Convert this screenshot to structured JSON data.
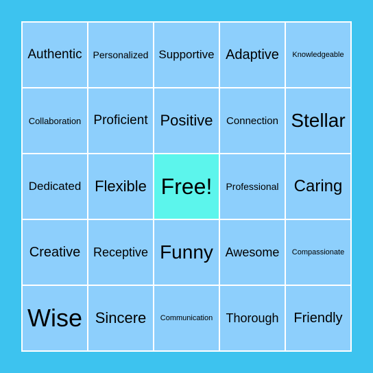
{
  "board": {
    "colors": {
      "background": "#3dc3ef",
      "cell": "#8dcffc",
      "free_cell": "#5cf5ec",
      "grid_lines": "#ffffff"
    },
    "rows": [
      [
        "Authentic",
        "Personalized",
        "Supportive",
        "Adaptive",
        "Knowledgeable"
      ],
      [
        "Collaboration",
        "Proficient",
        "Positive",
        "Connection",
        "Stellar"
      ],
      [
        "Dedicated",
        "Flexible",
        "Free!",
        "Professional",
        "Caring"
      ],
      [
        "Creative",
        "Receptive",
        "Funny",
        "Awesome",
        "Compassionate"
      ],
      [
        "Wise",
        "Sincere",
        "Communication",
        "Thorough",
        "Friendly"
      ]
    ]
  }
}
